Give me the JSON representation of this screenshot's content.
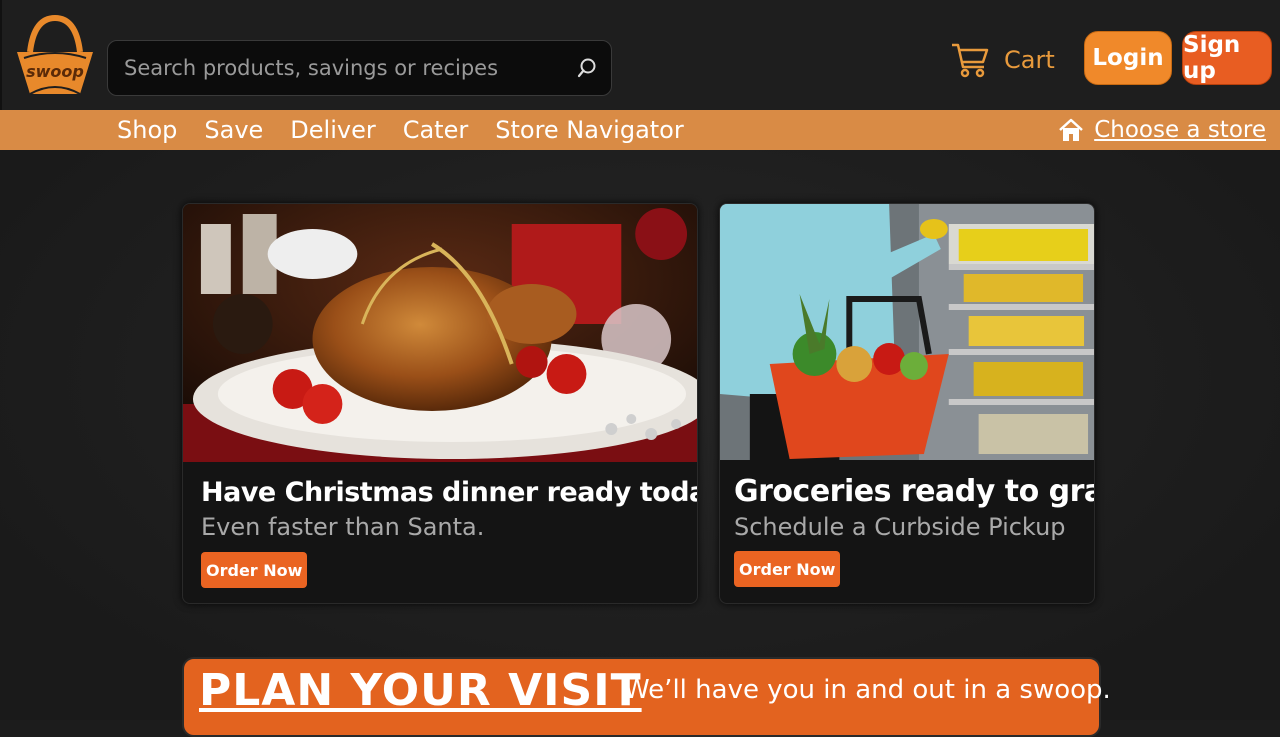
{
  "header": {
    "logo_text": "swoop",
    "search_placeholder": "Search products, savings or recipes",
    "cart_label": "Cart",
    "login_label": "Login",
    "signup_label": "Sign up"
  },
  "nav": {
    "items": [
      "Shop",
      "Save",
      "Deliver",
      "Cater",
      "Store Navigator"
    ],
    "store_label": "Choose a store"
  },
  "cards": [
    {
      "title": "Have Christmas dinner ready today.",
      "subtitle": "Even faster than Santa.",
      "button": "Order Now"
    },
    {
      "title": "Groceries ready to grab.",
      "subtitle": "Schedule a Curbside Pickup",
      "button": "Order Now"
    }
  ],
  "plan": {
    "title": "PLAN YOUR VISIT",
    "subtitle": "We’ll have you in and out in a swoop."
  },
  "colors": {
    "accent_orange": "#e85d22",
    "nav_bar": "#d98b45",
    "login_orange": "#f0892a",
    "background": "#1c1c1c"
  }
}
